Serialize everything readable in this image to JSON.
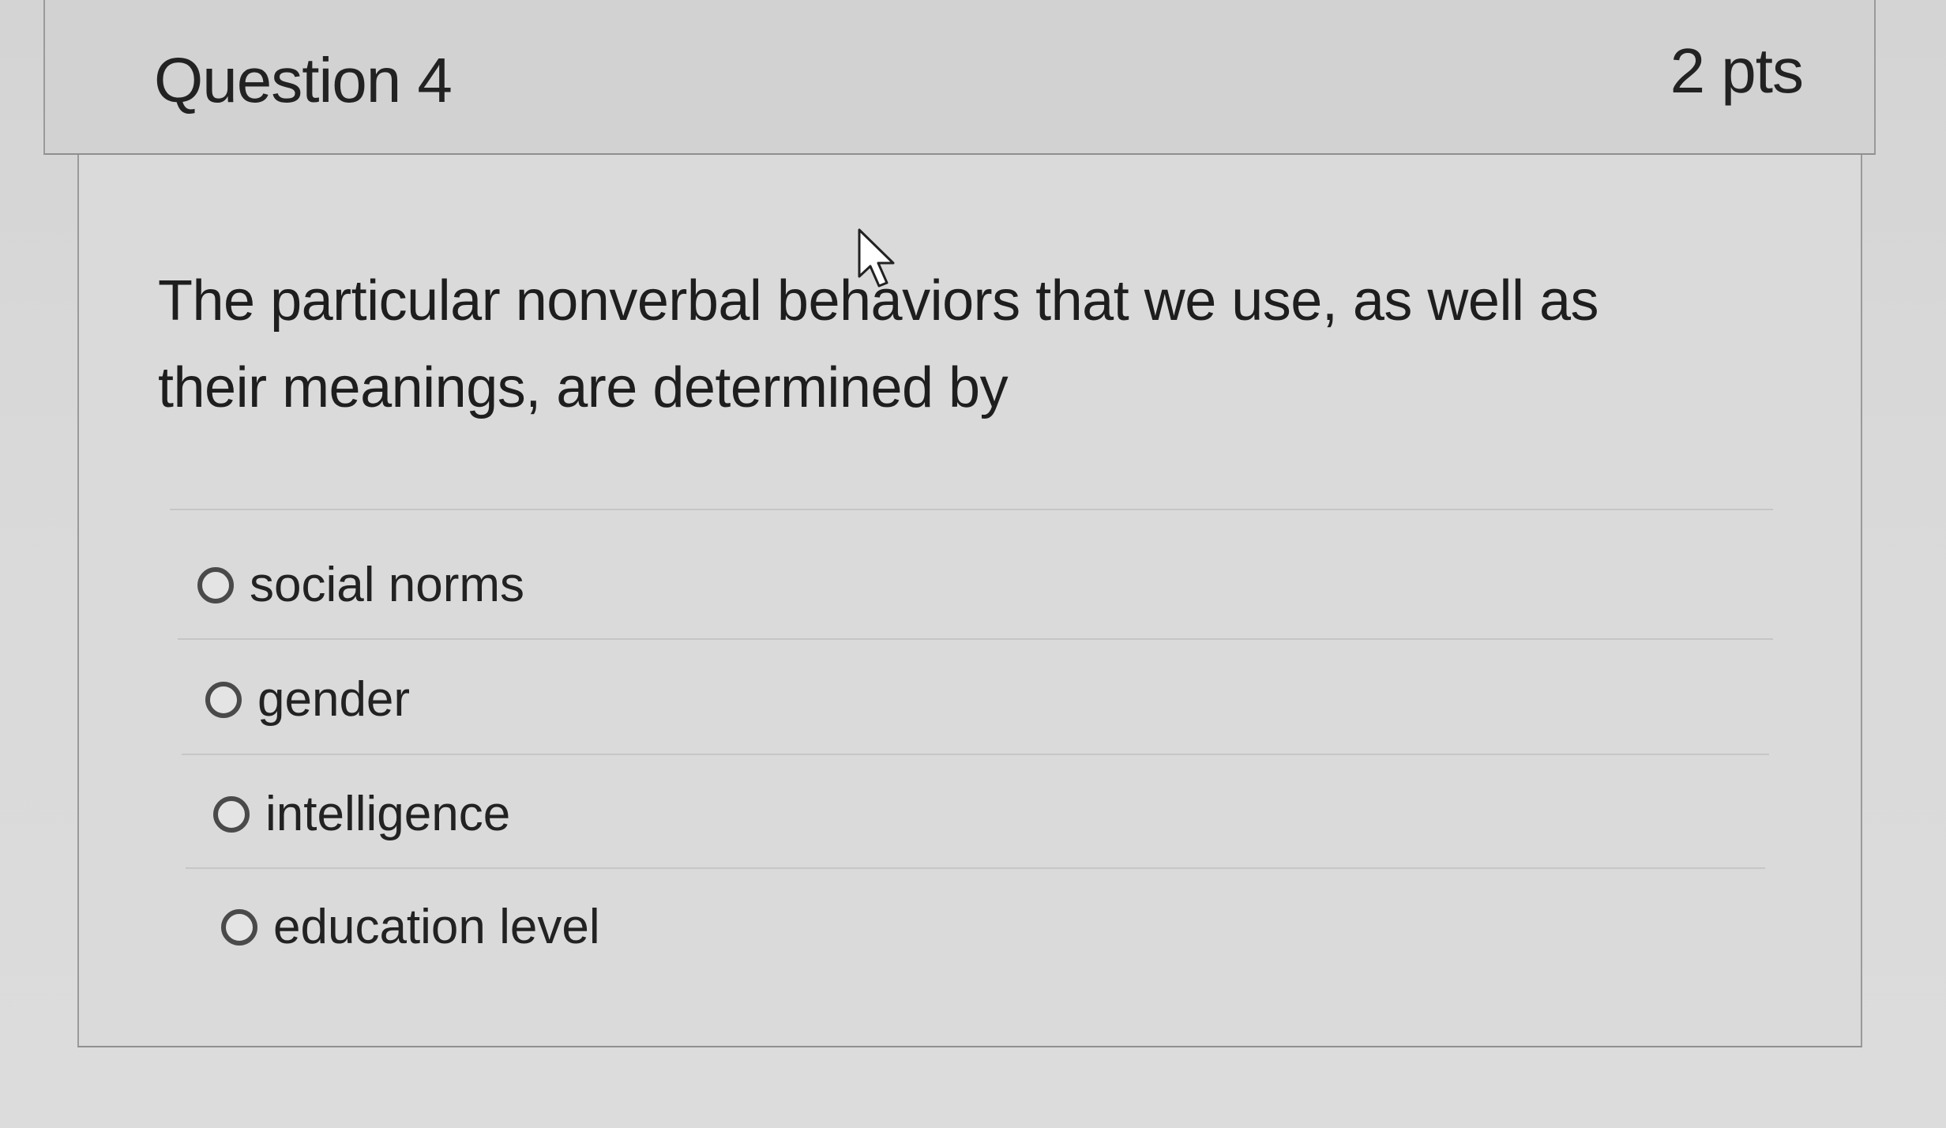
{
  "question": {
    "title": "Question 4",
    "points": "2 pts",
    "text": "The particular nonverbal behaviors that we use, as well as their meanings, are determined by"
  },
  "answers": [
    {
      "label": "social norms",
      "selected": false
    },
    {
      "label": "gender",
      "selected": false
    },
    {
      "label": "intelligence",
      "selected": false
    },
    {
      "label": "education level",
      "selected": false
    }
  ],
  "icons": {
    "radio": "radio-button-icon",
    "cursor": "mouse-pointer-icon"
  },
  "colors": {
    "header_bg": "#d2d2d2",
    "body_bg": "#dadada",
    "text": "#222222",
    "radio_border": "#4a4a4a"
  }
}
